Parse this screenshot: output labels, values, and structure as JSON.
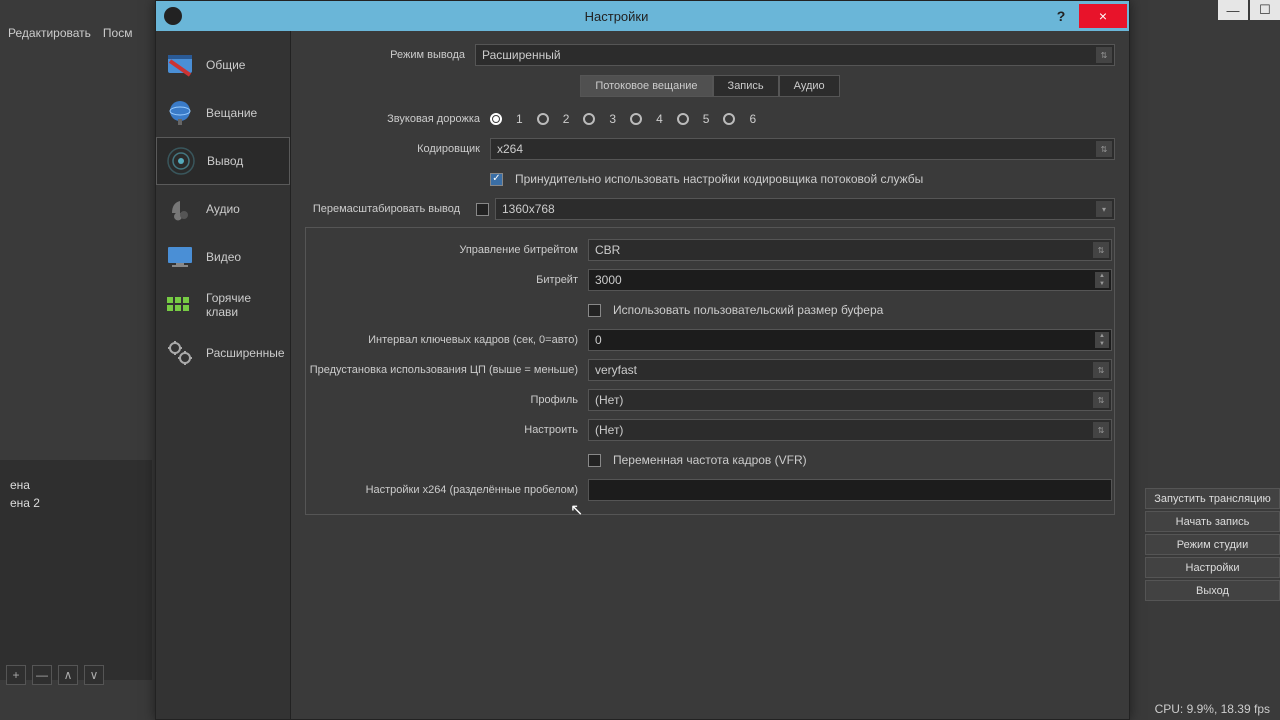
{
  "main_window": {
    "menu": [
      "Редактировать",
      "Посм"
    ],
    "left_list": [
      "ена",
      "ена 2"
    ],
    "right_buttons": [
      "Запустить трансляцию",
      "Начать запись",
      "Режим студии",
      "Настройки",
      "Выход"
    ],
    "status": "CPU: 9.9%, 18.39 fps"
  },
  "dialog": {
    "title": "Настройки",
    "help": "?",
    "close": "×",
    "sidebar": [
      {
        "label": "Общие",
        "icon": "general"
      },
      {
        "label": "Вещание",
        "icon": "stream"
      },
      {
        "label": "Вывод",
        "icon": "output",
        "active": true
      },
      {
        "label": "Аудио",
        "icon": "audio"
      },
      {
        "label": "Видео",
        "icon": "video"
      },
      {
        "label": "Горячие клави",
        "icon": "hotkeys"
      },
      {
        "label": "Расширенные",
        "icon": "advanced"
      }
    ],
    "output_mode": {
      "label": "Режим вывода",
      "value": "Расширенный"
    },
    "tabs": [
      "Потоковое вещание",
      "Запись",
      "Аудио"
    ],
    "active_tab": 0,
    "audio_track": {
      "label": "Звуковая дорожка",
      "options": [
        "1",
        "2",
        "3",
        "4",
        "5",
        "6"
      ],
      "selected": 0
    },
    "encoder": {
      "label": "Кодировщик",
      "value": "x264"
    },
    "enforce": {
      "label": "Принудительно использовать настройки кодировщика потоковой службы",
      "checked": true
    },
    "rescale": {
      "label": "Перемасштабировать вывод",
      "checked": false,
      "placeholder": "1360x768"
    },
    "bitrate_ctrl": {
      "label": "Управление битрейтом",
      "value": "CBR"
    },
    "bitrate": {
      "label": "Битрейт",
      "value": "3000"
    },
    "custom_buffer": {
      "label": "Использовать пользовательский размер буфера",
      "checked": false
    },
    "keyint": {
      "label": "Интервал ключевых кадров (сек, 0=авто)",
      "value": "0"
    },
    "preset": {
      "label": "Предустановка использования ЦП (выше = меньше)",
      "value": "veryfast"
    },
    "profile": {
      "label": "Профиль",
      "value": "(Нет)"
    },
    "tune": {
      "label": "Настроить",
      "value": "(Нет)"
    },
    "vfr": {
      "label": "Переменная частота кадров (VFR)",
      "checked": false
    },
    "x264opts": {
      "label": "Настройки x264 (разделённые пробелом)",
      "value": ""
    }
  }
}
